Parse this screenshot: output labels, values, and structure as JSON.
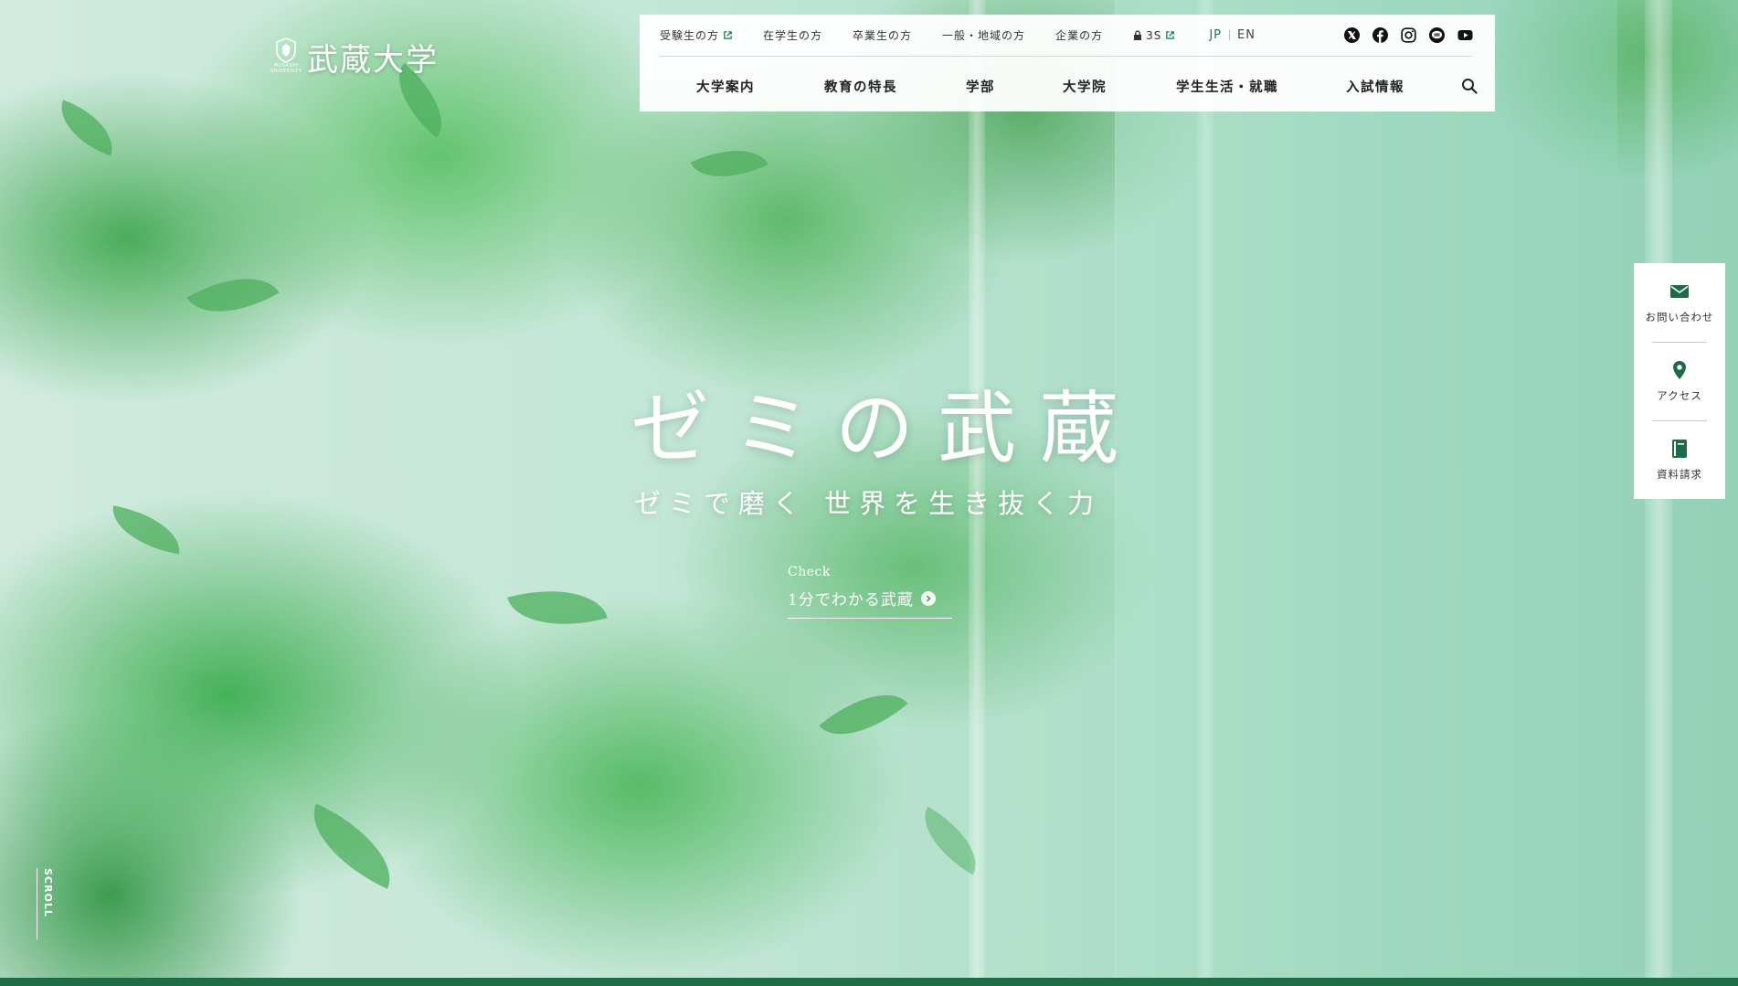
{
  "brand": {
    "name": "武蔵大学",
    "crest_text": "MUSASHI UNIVERSITY",
    "accent": "#1a7a4a",
    "dark_green": "#1f6b47"
  },
  "utility_nav": {
    "items": [
      {
        "label": "受験生の方",
        "external": true
      },
      {
        "label": "在学生の方",
        "external": false
      },
      {
        "label": "卒業生の方",
        "external": false
      },
      {
        "label": "一般・地域の方",
        "external": false
      },
      {
        "label": "企業の方",
        "external": false
      },
      {
        "label": "3S",
        "external": true,
        "locked": true
      }
    ],
    "lang": {
      "jp": "JP",
      "en": "EN",
      "active": "JP"
    },
    "social": [
      "x-icon",
      "facebook-icon",
      "instagram-icon",
      "line-icon",
      "youtube-icon"
    ]
  },
  "main_nav": {
    "items": [
      "大学案内",
      "教育の特長",
      "学部",
      "大学院",
      "学生生活・就職",
      "入試情報"
    ]
  },
  "hero": {
    "title": "ゼミの武蔵",
    "subtitle": "ゼミで磨く 世界を生き抜く力",
    "check_label": "Check",
    "check_link": "1分でわかる武蔵"
  },
  "side_menu": [
    {
      "label": "お問い合わせ",
      "icon": "mail-icon"
    },
    {
      "label": "アクセス",
      "icon": "map-pin-icon"
    },
    {
      "label": "資料請求",
      "icon": "book-icon"
    }
  ],
  "scroll": {
    "label": "SCROLL"
  }
}
